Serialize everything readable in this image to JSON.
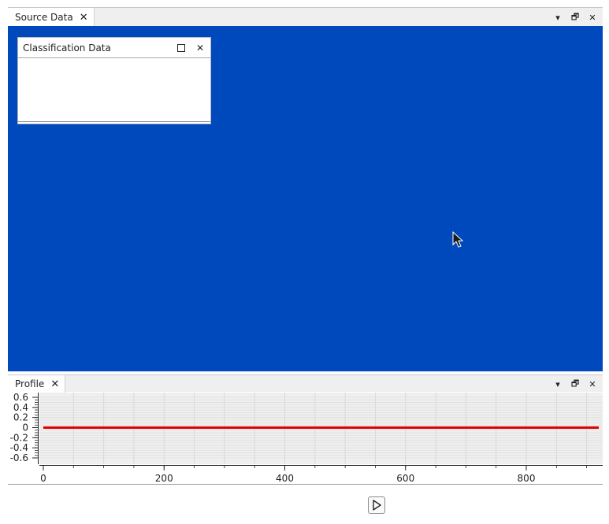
{
  "source_dock": {
    "tab_label": "Source Data",
    "tab_close": "✕",
    "controls": {
      "menu": "▾",
      "float": "🗗",
      "close": "✕"
    },
    "view_background": "#0049bd"
  },
  "classification_window": {
    "title": "Classification Data",
    "close": "✕"
  },
  "profile_dock": {
    "tab_label": "Profile",
    "tab_close": "✕",
    "controls": {
      "menu": "▾",
      "float": "🗗",
      "close": "✕"
    }
  },
  "icons": {
    "cursor": "arrow-cursor-icon",
    "play": "play-icon"
  },
  "colors": {
    "profile_line": "#e00000",
    "plot_background": "#efefef",
    "grid": "#d8d8d8"
  },
  "chart_data": {
    "type": "line",
    "title": "",
    "xlabel": "",
    "ylabel": "",
    "xlim": [
      0,
      920
    ],
    "ylim": [
      -0.6,
      0.6
    ],
    "x_ticks": [
      0,
      200,
      400,
      600,
      800
    ],
    "y_ticks": [
      0.6,
      0.4,
      0.2,
      0,
      -0.2,
      -0.4,
      -0.6
    ],
    "x_tick_labels": [
      "0",
      "200",
      "400",
      "600",
      "800"
    ],
    "y_tick_labels": [
      "0.6",
      "0.4",
      "0.2",
      "0",
      "-0.2",
      "-0.4",
      "-0.6"
    ],
    "grid": true,
    "series": [
      {
        "x": [
          0,
          920
        ],
        "y": [
          0,
          0
        ],
        "color": "#e00000"
      }
    ]
  }
}
